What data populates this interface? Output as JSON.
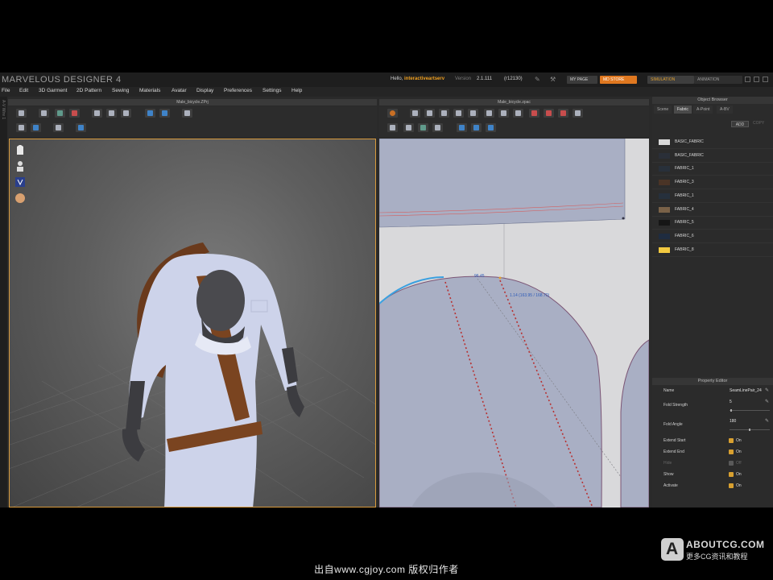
{
  "app": {
    "title": "MARVELOUS DESIGNER 4",
    "hello_prefix": "Hello,",
    "username": "interactiveartserv",
    "version_label": "Version",
    "version": "2.1.111",
    "build": "(r12130)",
    "buttons": {
      "my_page": "MY PAGE",
      "md_store": "MD STORE",
      "simulation": "SIMULATION",
      "animation": "ANIMATION"
    }
  },
  "menu": [
    "File",
    "Edit",
    "3D Garment",
    "2D Pattern",
    "Sewing",
    "Materials",
    "Avatar",
    "Display",
    "Preferences",
    "Settings",
    "Help"
  ],
  "side_strip_label": "A-V Wire 1",
  "panels": {
    "view3d_title": "Male_bicycle.ZPrj",
    "view2d_title": "Male_bicycle.zpac"
  },
  "pattern": {
    "measure_top": "96.45",
    "measure_line": "1.14 (163.95 / 168.70)"
  },
  "object_browser": {
    "title": "Object Browser",
    "tabs": [
      "Scene",
      "Fabric",
      "A-Point",
      "A-BV"
    ],
    "active_tab": "Fabric",
    "add_label": "ADD",
    "copy_label": "COPY",
    "fabrics": [
      {
        "name": "BASIC_FABRIC",
        "color": "#d8d8d8"
      },
      {
        "name": "BASIC_FABRIC",
        "color": "#2a2f38"
      },
      {
        "name": "FABRIC_1",
        "color": "#28303a"
      },
      {
        "name": "FABRIC_3",
        "color": "#4a3426"
      },
      {
        "name": "FABRIC_1",
        "color": "#26303c"
      },
      {
        "name": "FABRIC_4",
        "color": "#7a6248"
      },
      {
        "name": "FABRIC_5",
        "color": "#161616"
      },
      {
        "name": "FABRIC_6",
        "color": "#1f2c40"
      },
      {
        "name": "FABRIC_8",
        "color": "#f2c940"
      }
    ]
  },
  "property_editor": {
    "title": "Property Editor",
    "name_label": "Name",
    "name_value": "SeamLinePair_24",
    "fold_strength_label": "Fold Strength",
    "fold_strength_value": "5",
    "fold_strength_level": 0.02,
    "fold_angle_label": "Fold Angle",
    "fold_angle_value": "180",
    "fold_angle_level": 0.5,
    "extend_start_label": "Extend Start",
    "extend_start_value": "On",
    "extend_end_label": "Extend End",
    "extend_end_value": "On",
    "hide_label": "Hide",
    "hide_value": "Off",
    "show_label": "Show",
    "show_value": "On",
    "activate_label": "Activate",
    "activate_value": "On"
  },
  "footer": {
    "credit": "出自www.cgjoy.com 版权归作者",
    "watermark_title": "ABOUTCG.COM",
    "watermark_sub": "更多CG资讯和教程"
  }
}
